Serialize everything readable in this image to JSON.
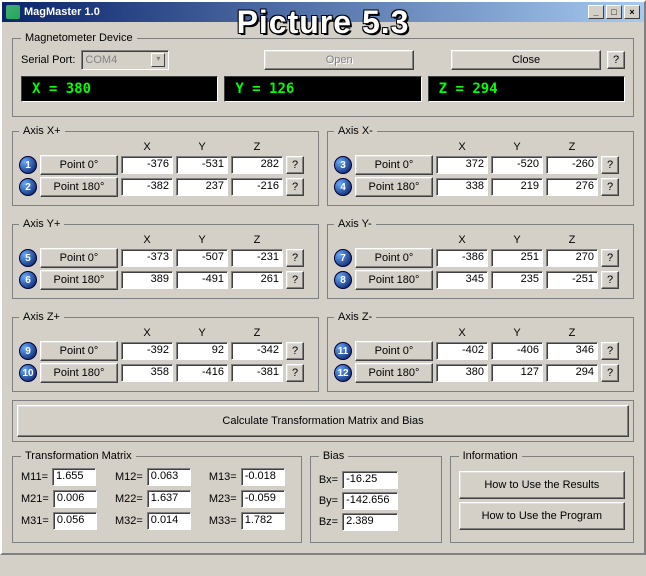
{
  "overlay": "Picture 5.3",
  "window": {
    "title": "MagMaster 1.0"
  },
  "device": {
    "legend": "Magnetometer Device",
    "serial_label": "Serial Port:",
    "serial_value": "COM4",
    "open": "Open",
    "close": "Close",
    "help": "?"
  },
  "lcd": {
    "x": "X = 380",
    "y": "Y = 126",
    "z": "Z = 294"
  },
  "axis_labels": {
    "X": "X",
    "Y": "Y",
    "Z": "Z",
    "p0": "Point 0°",
    "p180": "Point 180°",
    "q": "?"
  },
  "axes": {
    "Xp": {
      "legend": "Axis X+",
      "b0": "1",
      "b180": "2",
      "r0": {
        "x": "-376",
        "y": "-531",
        "z": "282"
      },
      "r180": {
        "x": "-382",
        "y": "237",
        "z": "-216"
      }
    },
    "Xm": {
      "legend": "Axis X-",
      "b0": "3",
      "b180": "4",
      "r0": {
        "x": "372",
        "y": "-520",
        "z": "-260"
      },
      "r180": {
        "x": "338",
        "y": "219",
        "z": "276"
      }
    },
    "Yp": {
      "legend": "Axis Y+",
      "b0": "5",
      "b180": "6",
      "r0": {
        "x": "-373",
        "y": "-507",
        "z": "-231"
      },
      "r180": {
        "x": "389",
        "y": "-491",
        "z": "261"
      }
    },
    "Ym": {
      "legend": "Axis Y-",
      "b0": "7",
      "b180": "8",
      "r0": {
        "x": "-386",
        "y": "251",
        "z": "270"
      },
      "r180": {
        "x": "345",
        "y": "235",
        "z": "-251"
      }
    },
    "Zp": {
      "legend": "Axis Z+",
      "b0": "9",
      "b180": "10",
      "r0": {
        "x": "-392",
        "y": "92",
        "z": "-342"
      },
      "r180": {
        "x": "358",
        "y": "-416",
        "z": "-381"
      }
    },
    "Zm": {
      "legend": "Axis Z-",
      "b0": "11",
      "b180": "12",
      "r0": {
        "x": "-402",
        "y": "-406",
        "z": "346"
      },
      "r180": {
        "x": "380",
        "y": "127",
        "z": "294"
      }
    }
  },
  "calc": "Calculate Transformation Matrix and Bias",
  "matrix": {
    "legend": "Transformation Matrix",
    "M11_l": "M11=",
    "M11": "1.655",
    "M12_l": "M12=",
    "M12": "0.063",
    "M13_l": "M13=",
    "M13": "-0.018",
    "M21_l": "M21=",
    "M21": "0.006",
    "M22_l": "M22=",
    "M22": "1.637",
    "M23_l": "M23=",
    "M23": "-0.059",
    "M31_l": "M31=",
    "M31": "0.056",
    "M32_l": "M32=",
    "M32": "0.014",
    "M33_l": "M33=",
    "M33": "1.782"
  },
  "bias": {
    "legend": "Bias",
    "Bx_l": "Bx=",
    "Bx": "-16.25",
    "By_l": "By=",
    "By": "-142.656",
    "Bz_l": "Bz=",
    "Bz": "2.389"
  },
  "info": {
    "legend": "Information",
    "results": "How to Use the Results",
    "program": "How to Use the Program"
  }
}
